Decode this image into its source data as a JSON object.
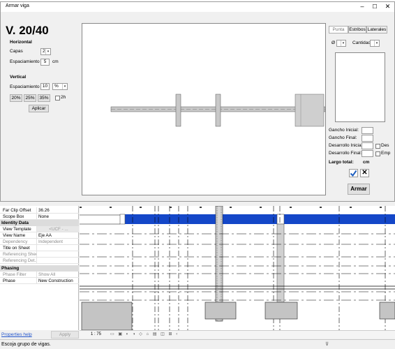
{
  "dialog": {
    "title": "Armar viga",
    "beam_title": "V. 20/40",
    "horizontal": {
      "section": "Horizontal",
      "capas_label": "Capas",
      "capas_value": "2",
      "espaciamiento_label": "Espaciamiento",
      "espaciamiento_value": "5",
      "unit": "cm"
    },
    "vertical": {
      "section": "Vertical",
      "espaciamiento_label": "Espaciamiento",
      "espaciamiento_value": "10",
      "unit_select": "%",
      "pct_buttons": [
        "20%",
        "25%",
        "35%"
      ],
      "checkbox_label": "2h",
      "apply_button": "Aplicar"
    },
    "tabs": [
      "Punta",
      "Estribos",
      "Laterales"
    ],
    "active_tab": "Punta",
    "diam_symbol": "Ø",
    "cantidad_label": "Cantidad",
    "fields": {
      "gancho_inicial": "Gancho Inicial:",
      "gancho_final": "Gancho Final:",
      "desarrollo_inicial": "Desarrollo Inicial:",
      "desarrollo_final": "Desarrollo Final:",
      "des_label": "Des",
      "emp_label": "Emp",
      "largo_total": "Largo total:",
      "largo_unit": "cm"
    },
    "armar_button": "Armar"
  },
  "properties": {
    "rows_top": [
      {
        "key": "Far Clip Offset",
        "value": "36.26",
        "grey": false
      },
      {
        "key": "Scope Box",
        "value": "None",
        "grey": false
      }
    ],
    "identity_header": "Identity Data",
    "identity_rows": [
      {
        "key": "View Template",
        "value": "<UCF - ...",
        "grey": false
      },
      {
        "key": "View Name",
        "value": "Eje AA",
        "grey": false
      },
      {
        "key": "Dependency",
        "value": "Independent",
        "grey": true
      },
      {
        "key": "Title on Sheet",
        "value": "",
        "grey": false
      },
      {
        "key": "Referencing Sheet",
        "value": "",
        "grey": true
      },
      {
        "key": "Referencing Det...",
        "value": "",
        "grey": true
      }
    ],
    "phasing_header": "Phasing",
    "phasing_rows": [
      {
        "key": "Phase Filter",
        "value": "Show All",
        "grey": true
      },
      {
        "key": "Phase",
        "value": "New Construction",
        "grey": false
      }
    ],
    "help_link": "Properties help",
    "apply": "Apply"
  },
  "view": {
    "scale": "1 : 75"
  },
  "status": {
    "message": "Escoja grupo de vigas."
  },
  "colors": {
    "beam_blue": "#1447c8",
    "rebar_grey": "#c8c8c8",
    "column_grey": "#bdbdbd"
  }
}
